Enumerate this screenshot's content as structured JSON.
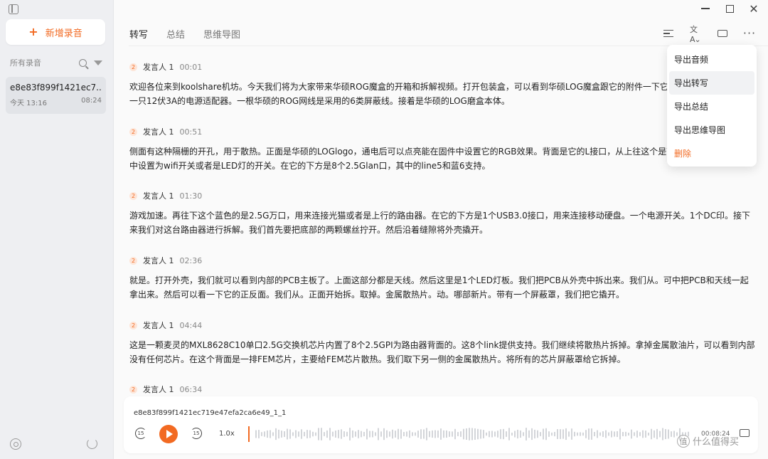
{
  "sidebar": {
    "new_button_label": "新增录音",
    "section_title": "所有录音",
    "record": {
      "name": "e8e83f899f1421ec7...",
      "date": "今天 13:16",
      "duration": "08:24"
    }
  },
  "tabs": [
    "转写",
    "总结",
    "思维导图"
  ],
  "active_tab": 0,
  "menu": [
    "导出音频",
    "导出转写",
    "导出总结",
    "导出思维导图",
    "删除"
  ],
  "segments": [
    {
      "speaker": "发言人 1",
      "time": "00:01",
      "text": "欢迎各位来到koolshare机坊。今天我们将为大家带来华硕ROG魔盒的开箱和拆解视频。打开包装盒，可以看到华硕LOG魔盒跟它的附件一下它的附件。附件中提供有一只12伏3A的电源适配器。一根华硕的ROG网线是采用的6类屏蔽线。接着是华硕的LOG磨盒本体。"
    },
    {
      "speaker": "发言人 1",
      "time": "00:51",
      "text": "侧面有这种隔栅的开孔，用于散热。正面是华硕的LOGlogo，通电后可以点亮能在固件中设置它的RGB效果。背面是它的L接口，从上往这个是WPS按钮，可以在固件中设置为wifi开关或者是LED灯的开关。在它的下方是8个2.5Glan口，其中的line5和蓝6支持。"
    },
    {
      "speaker": "发言人 1",
      "time": "01:30",
      "text": "游戏加速。再往下这个蓝色的是2.5G万口，用来连接光猫或者是上行的路由器。在它的下方是1个USB3.0接口，用来连接移动硬盘。一个电源开关。1个DC印。接下来我们对这台路由器进行拆解。我们首先要把底部的两颗螺丝拧开。然后沿着缝隙将外壳撬开。"
    },
    {
      "speaker": "发言人 1",
      "time": "02:36",
      "text": "就是。打开外壳，我们就可以看到内部的PCB主板了。上面这部分都是天线。然后这里是1个LED灯板。我们把PCB从外壳中拆出来。我们从。可中把PCB和天线一起拿出来。然后可以看一下它的正反面。我们从。正面开始拆。取掉。金属散热片。动。哪部新片。带有一个屏蔽罩，我们把它撬开。"
    },
    {
      "speaker": "发言人 1",
      "time": "04:44",
      "text": "这是一颗麦灵的MXL8628C10单口2.5G交换机芯片内置了8个2.5GPI为路由器背面的。这8个link提供支持。我们继续将散热片拆掉。拿掉金属散油片，可以看到内部没有任何芯片。在这个背面是一排FEM芯片，主要给FEM芯片散热。我们取下另一侧的金属散热片。将所有的芯片屏蔽罩给它拆掉。"
    },
    {
      "speaker": "发言人 1",
      "time": "06:34",
      "text": ""
    }
  ],
  "player": {
    "filename": "e8e83f899f1421ec719e47efa2ca6e49_1_1",
    "speed": "1.0x",
    "time": "00:08:24",
    "progress": 0.0,
    "skip_back": "15",
    "skip_forward": "15"
  },
  "watermark": "什么值得买",
  "watermark_badge": "值",
  "colors": {
    "accent": "#f26a22"
  },
  "icons": {
    "sidebar_toggle": "sidebar-toggle-icon",
    "search": "search-icon",
    "filter": "filter-icon",
    "settings": "settings-icon",
    "sync": "sync-icon",
    "minimize": "minimize-icon",
    "maximize": "maximize-icon",
    "close": "close-icon"
  }
}
